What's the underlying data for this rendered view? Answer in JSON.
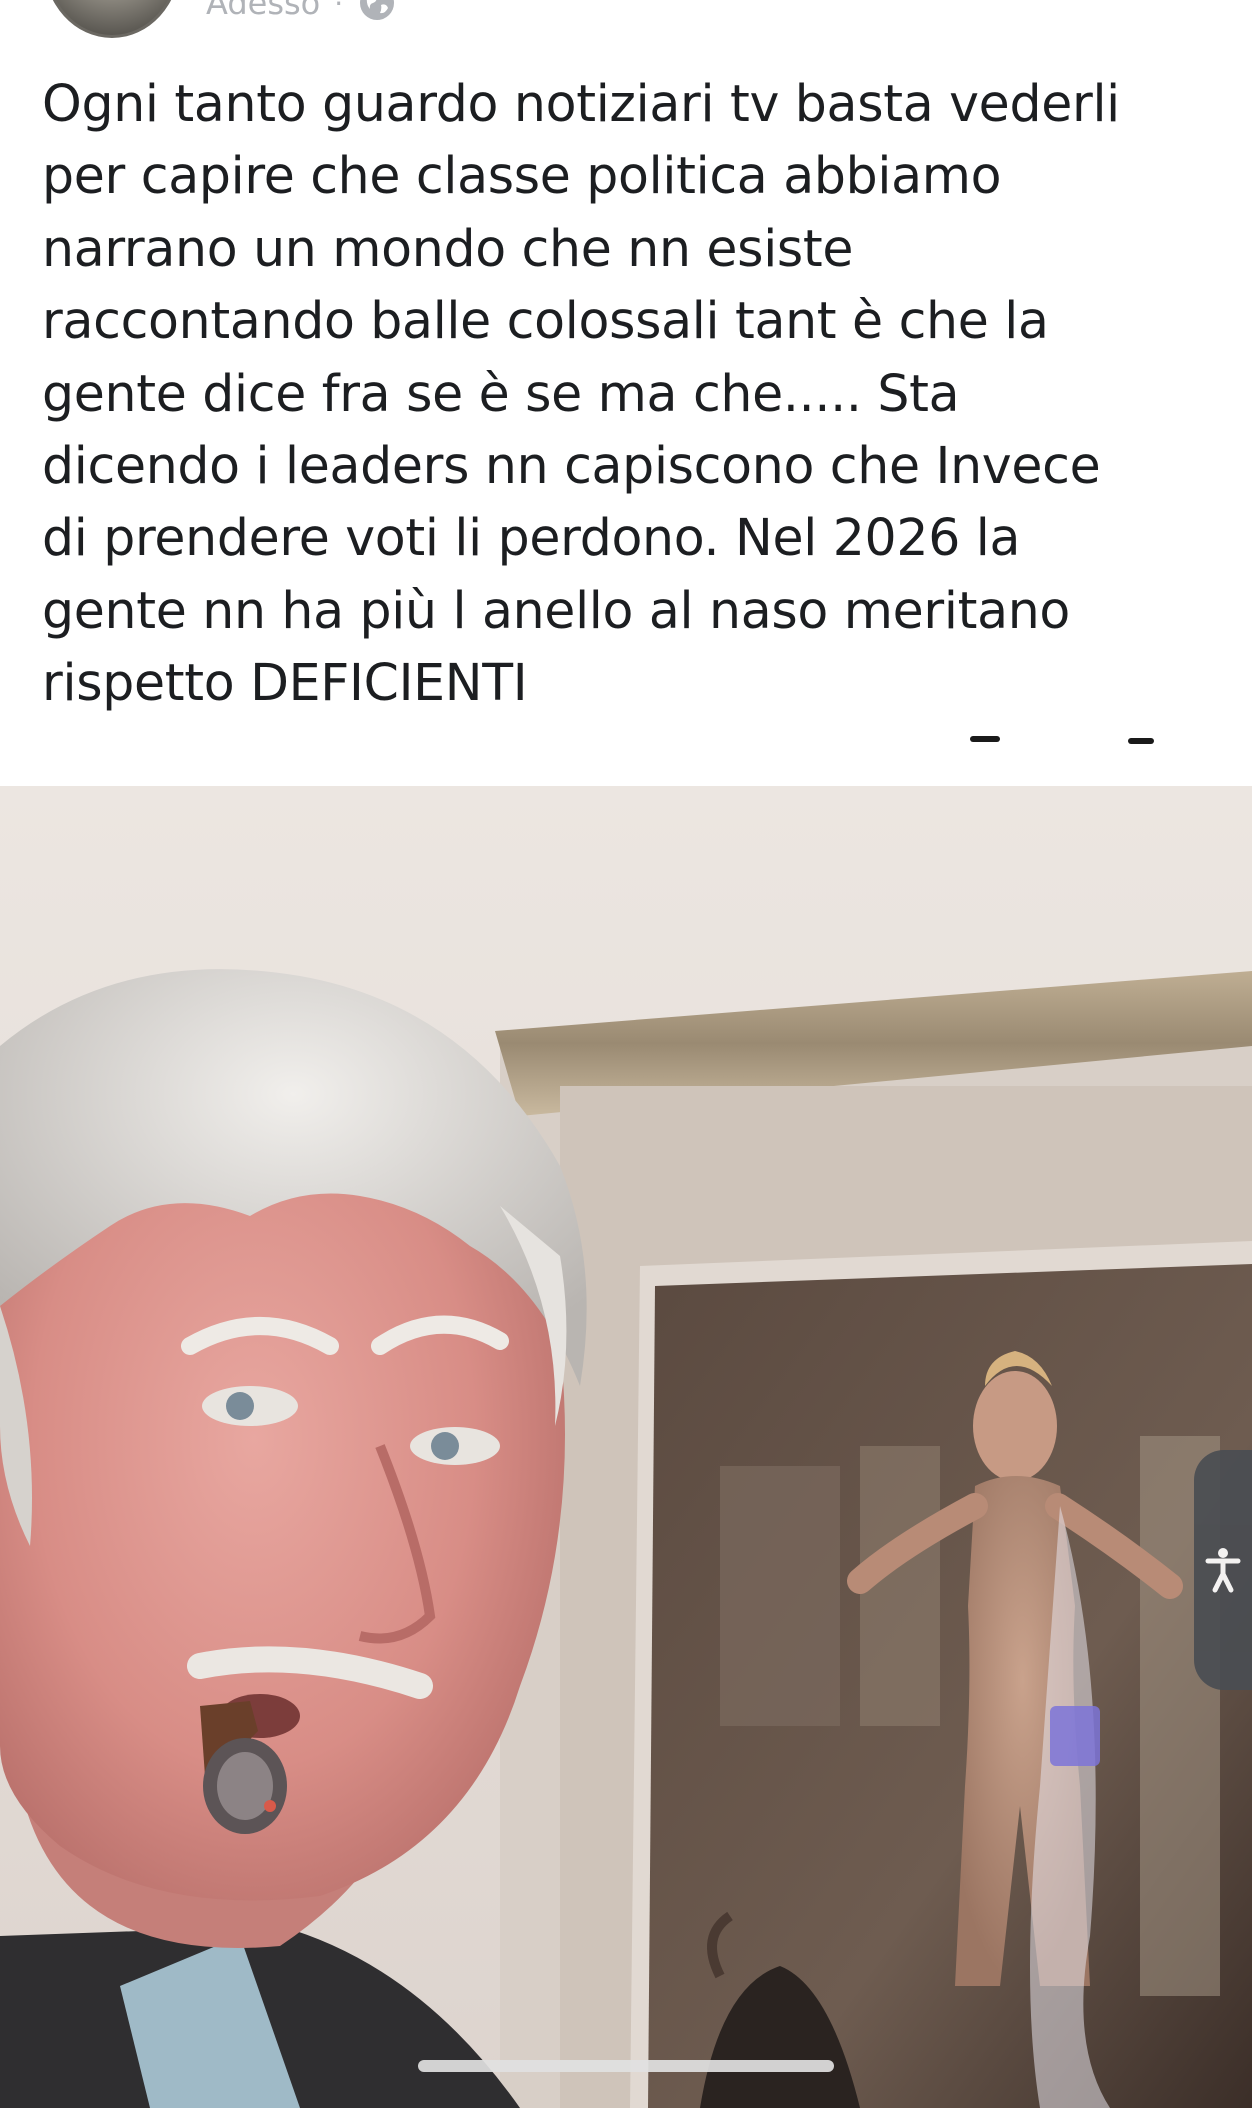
{
  "post": {
    "timestamp": "Adesso",
    "separator": "·",
    "privacy_icon": "globe-icon",
    "text": "Ogni tanto guardo notiziari tv basta vederli\nper capire che classe politica abbiamo\nnarrano un mondo che nn esiste\nraccontando balle colossali tant è che la\ngente dice fra se è se ma che..... Sta\ndicendo i leaders nn capiscono che Invece\ndi prendere voti li perdono. Nel 2026 la\ngente nn ha più l anello al naso meritano\nrispetto DEFICIENTI"
  },
  "accessibility": {
    "icon": "accessibility-person-icon"
  },
  "colors": {
    "text": "#1c1e21",
    "meta": "#b0b3b8",
    "tab": "#4a4d52"
  }
}
